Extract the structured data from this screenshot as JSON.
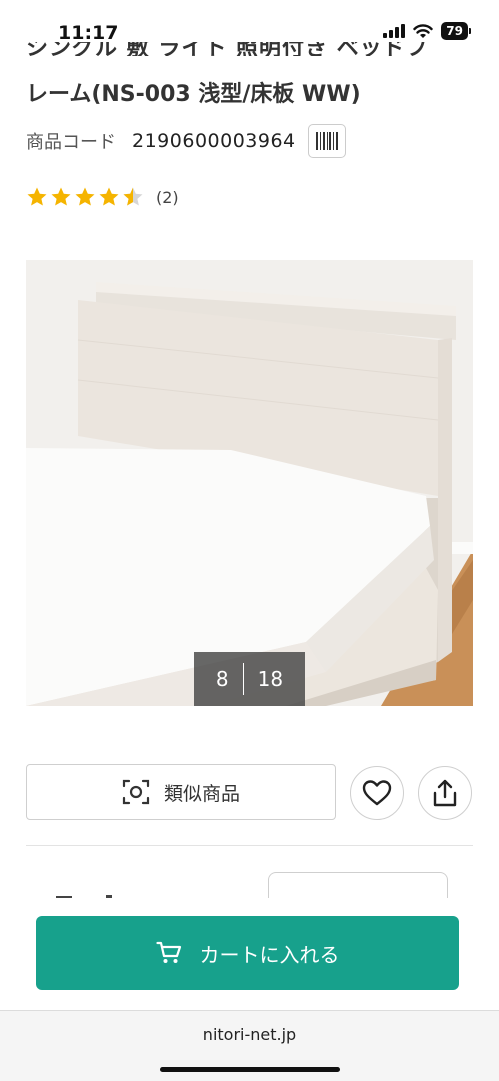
{
  "status": {
    "time": "11:17",
    "battery": "79"
  },
  "product": {
    "title_line1": "シングル 敷 ライト 照明付き ベッドフ",
    "title_line2": "レーム(NS-003 浅型/床板 WW)",
    "code_label": "商品コード",
    "code_value": "2190600003964",
    "rating": 4.5,
    "review_count": "(2)"
  },
  "gallery": {
    "current": "8",
    "total": "18"
  },
  "actions": {
    "similar_label": "類似商品",
    "favorite_icon": "heart-icon",
    "share_icon": "share-icon"
  },
  "cart": {
    "label": "カートに入れる"
  },
  "browser": {
    "url": "nitori-net.jp"
  },
  "colors": {
    "accent": "#17a18c",
    "star": "#f5b400"
  }
}
